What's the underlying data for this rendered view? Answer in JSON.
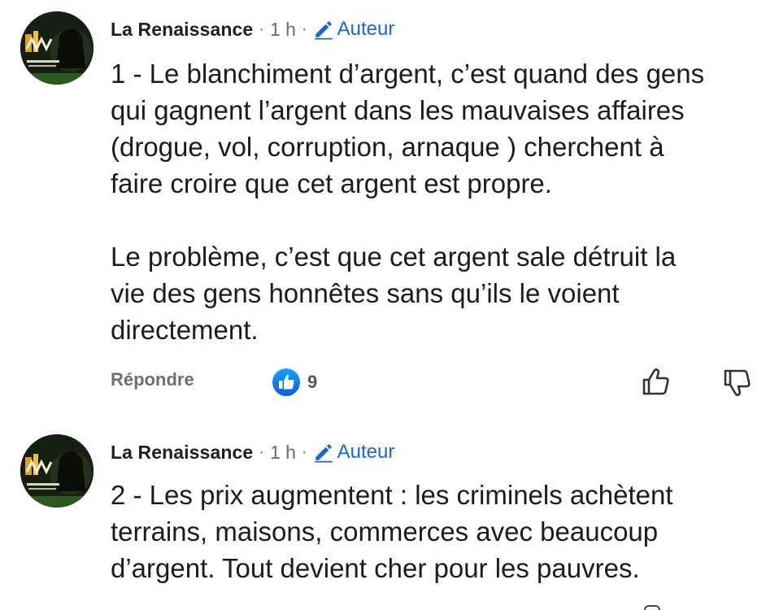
{
  "comments": [
    {
      "author": "La Renaissance",
      "separator": "·",
      "time": "1 h",
      "badge": "Auteur",
      "text": "1 - Le blanchiment d’argent, c’est quand des gens\nqui gagnent l’argent dans les mauvaises affaires\n(drogue, vol, corruption, arnaque ) cherchent à\nfaire croire que cet argent est propre.\n\nLe problème, c’est que cet argent sale détruit la\nvie des gens honnêtes sans qu’ils le voient\ndirectement.",
      "reply_label": "Répondre",
      "reaction_count": "9"
    },
    {
      "author": "La Renaissance",
      "separator": "·",
      "time": "1 h",
      "badge": "Auteur",
      "text": "2 - Les prix augmentent : les criminels achètent\nterrains, maisons, commerces avec beaucoup\nd’argent. Tout devient cher pour les pauvres."
    }
  ],
  "colors": {
    "accent": "#1a66d2",
    "reaction_blue": "#1877f2",
    "meta_gray": "#6b6b6b"
  },
  "icons": {
    "badge": "pencil-icon",
    "reaction": "like-reaction-icon",
    "like": "thumb-up-icon",
    "dislike": "thumb-down-icon"
  }
}
